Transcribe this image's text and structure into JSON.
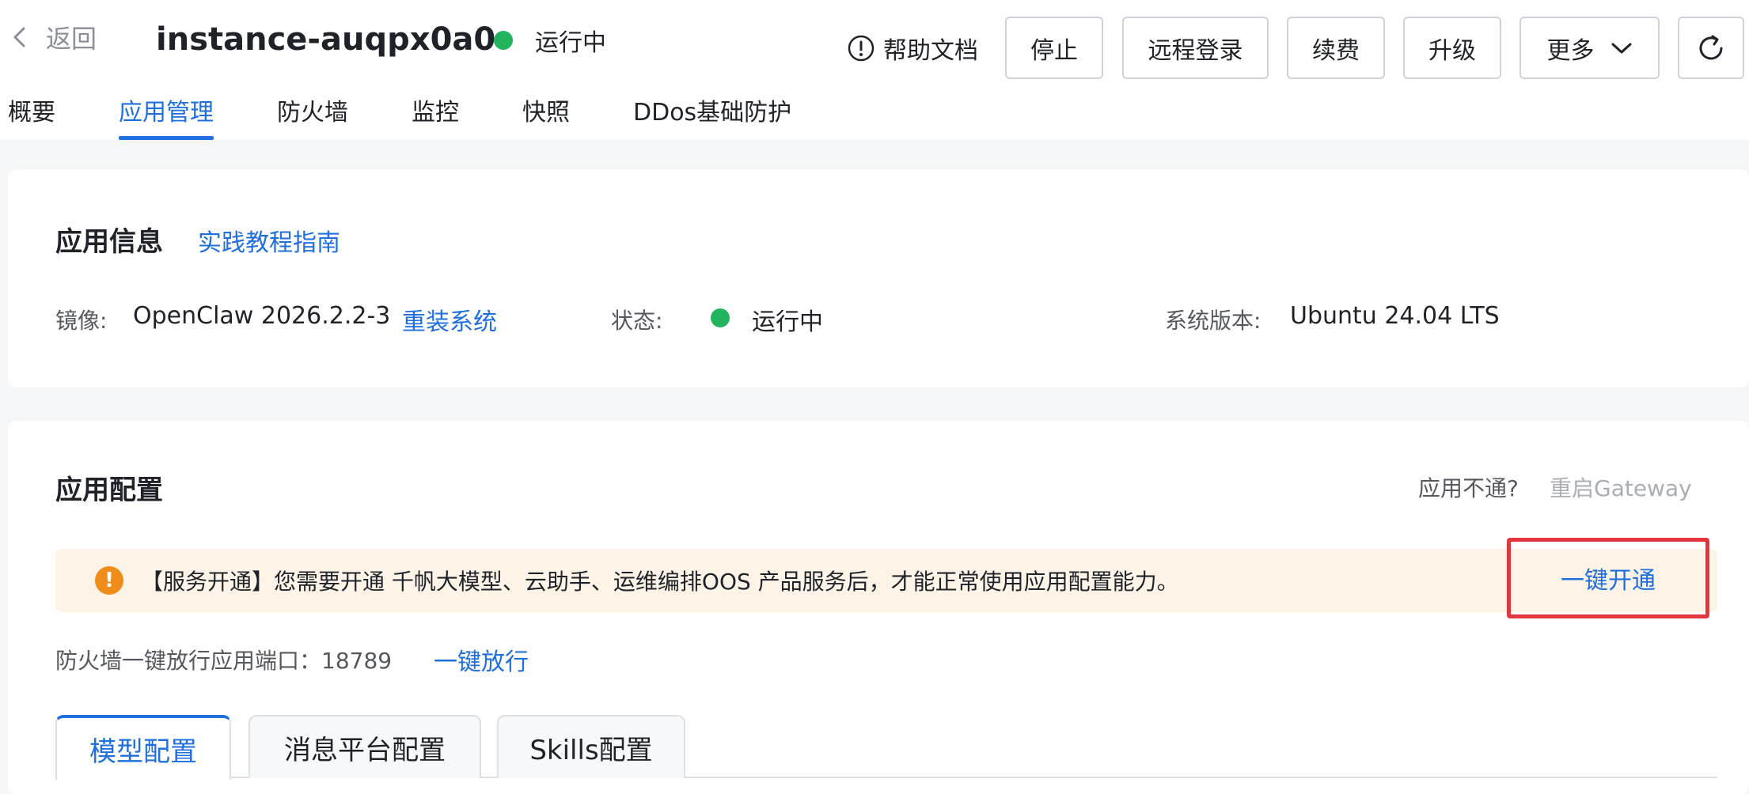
{
  "header": {
    "back_label": "返回",
    "instance_name": "instance-auqpx0a0",
    "status": "运行中",
    "help_label": "帮助文档",
    "buttons": {
      "stop": "停止",
      "remote_login": "远程登录",
      "renew": "续费",
      "upgrade": "升级",
      "more": "更多"
    }
  },
  "tabs": [
    {
      "label": "概要"
    },
    {
      "label": "应用管理"
    },
    {
      "label": "防火墙"
    },
    {
      "label": "监控"
    },
    {
      "label": "快照"
    },
    {
      "label": "DDos基础防护"
    }
  ],
  "app_info": {
    "title": "应用信息",
    "guide_link": "实践教程指南",
    "image_label": "镜像:",
    "image_value": "OpenClaw 2026.2.2-3",
    "reinstall_link": "重装系统",
    "status_label": "状态:",
    "status_value": "运行中",
    "os_label": "系统版本:",
    "os_value": "Ubuntu 24.04 LTS"
  },
  "app_config": {
    "title": "应用配置",
    "unreachable_label": "应用不通?",
    "restart_gateway": "重启Gateway",
    "banner_text": "【服务开通】您需要开通 千帆大模型、云助手、运维编排OOS 产品服务后，才能正常使用应用配置能力。",
    "activate_label": "一键开通",
    "firewall_text": "防火墙一键放行应用端口：18789",
    "firewall_link": "一键放行",
    "subtabs": [
      {
        "label": "模型配置"
      },
      {
        "label": "消息平台配置"
      },
      {
        "label": "Skills配置"
      }
    ]
  },
  "colors": {
    "accent": "#1f6fde",
    "running": "#22b35e",
    "warning": "#f08c1a",
    "highlight_box": "#e5363d"
  }
}
